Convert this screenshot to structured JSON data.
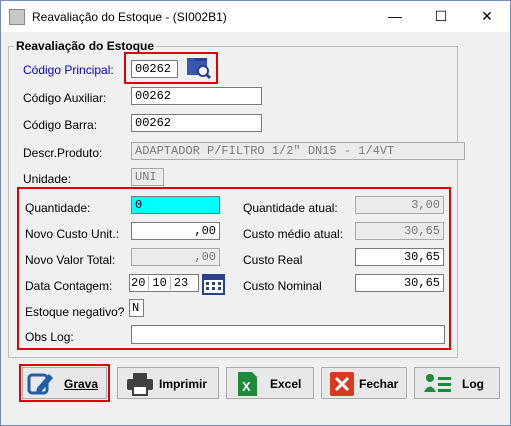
{
  "window": {
    "title": "Reavaliação do Estoque - (SI002B1)",
    "minimize": "—",
    "maximize": "☐",
    "close": "✕"
  },
  "group_title": "Reavaliação do Estoque",
  "fields": {
    "codigo_principal": {
      "label": "Código Principal:",
      "value": "00262"
    },
    "codigo_auxiliar": {
      "label": "Código Auxiliar:",
      "value": "00262"
    },
    "codigo_barra": {
      "label": "Código Barra:",
      "value": "00262"
    },
    "descr_produto": {
      "label": "Descr.Produto:",
      "value": "ADAPTADOR P/FILTRO 1/2\" DN15 - 1/4VT"
    },
    "unidade": {
      "label": "Unidade:",
      "value": "UNI"
    },
    "quantidade": {
      "label": "Quantidade:",
      "value": "0"
    },
    "novo_custo_unit": {
      "label": "Novo Custo Unit.:",
      "value": ",00"
    },
    "novo_valor_total": {
      "label": "Novo Valor Total:",
      "value": ",00"
    },
    "data_contagem": {
      "label": "Data Contagem:",
      "day": "20",
      "month": "10",
      "year": "23"
    },
    "estoque_negativo": {
      "label": "Estoque negativo?",
      "value": "N"
    },
    "obs_log": {
      "label": "Obs Log:",
      "value": ""
    },
    "quantidade_atual": {
      "label": "Quantidade atual:",
      "value": "3,00"
    },
    "custo_medio_atual": {
      "label": "Custo médio atual:",
      "value": "30,65"
    },
    "custo_real": {
      "label": "Custo Real",
      "value": "30,65"
    },
    "custo_nominal": {
      "label": "Custo Nominal",
      "value": "30,65"
    }
  },
  "buttons": {
    "grava": "Grava",
    "imprimir": "Imprimir",
    "excel": "Excel",
    "fechar": "Fechar",
    "log": "Log"
  },
  "colors": {
    "highlight": "#e00000",
    "quantity_bg": "#00ffff",
    "label_blue": "#0000d0"
  }
}
